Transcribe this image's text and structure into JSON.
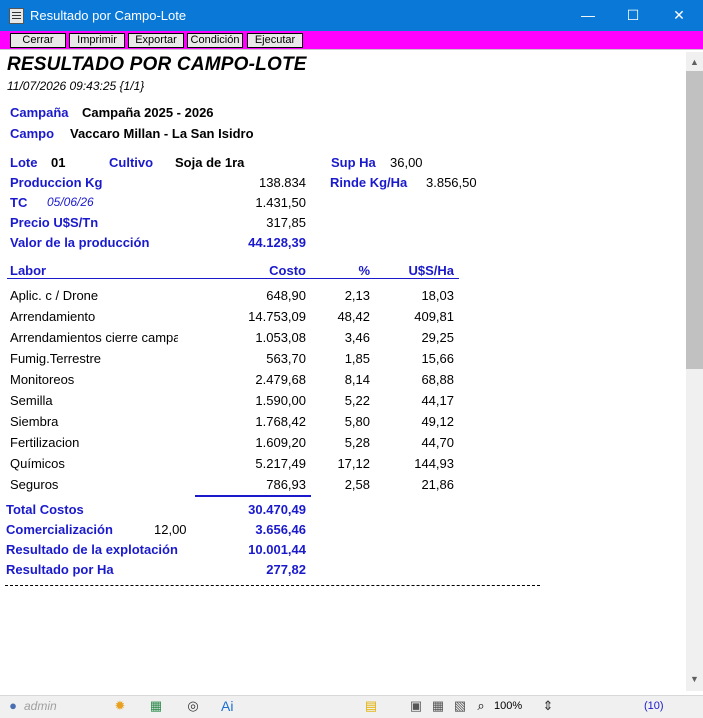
{
  "window": {
    "title": "Resultado por Campo-Lote",
    "minimize": "—",
    "maximize": "☐",
    "close": "✕"
  },
  "toolbar": {
    "cerrar": "Cerrar",
    "imprimir": "Imprimir",
    "exportar": "Exportar",
    "condicion": "Condición",
    "ejecutar": "Ejecutar"
  },
  "report": {
    "title": "RESULTADO POR CAMPO-LOTE",
    "datetime": "11/07/2026 09:43:25 {1/1}",
    "campana_label": "Campaña",
    "campana_value": "Campaña 2025 - 2026",
    "campo_label": "Campo",
    "campo_value": "Vaccaro Millan - La San Isidro",
    "lote_label": "Lote",
    "lote_value": "01",
    "cultivo_label": "Cultivo",
    "cultivo_value": "Soja de 1ra",
    "sup_label": "Sup Ha",
    "sup_value": "36,00",
    "prod_label": "Produccion Kg",
    "prod_value": "138.834",
    "rinde_label": "Rinde Kg/Ha",
    "rinde_value": "3.856,50",
    "tc_label": "TC",
    "tc_date": "05/06/26",
    "tc_value": "1.431,50",
    "precio_label": "Precio U$S/Tn",
    "precio_value": "317,85",
    "valor_label": "Valor de la producción",
    "valor_value": "44.128,39",
    "headers": {
      "labor": "Labor",
      "costo": "Costo",
      "pct": "%",
      "usha": "U$S/Ha"
    },
    "rows": [
      {
        "labor": "Aplic. c / Drone",
        "costo": "648,90",
        "pct": "2,13",
        "usha": "18,03"
      },
      {
        "labor": "Arrendamiento",
        "costo": "14.753,09",
        "pct": "48,42",
        "usha": "409,81"
      },
      {
        "labor": "Arrendamientos cierre campa",
        "costo": "1.053,08",
        "pct": "3,46",
        "usha": "29,25"
      },
      {
        "labor": "Fumig.Terrestre",
        "costo": "563,70",
        "pct": "1,85",
        "usha": "15,66"
      },
      {
        "labor": "Monitoreos",
        "costo": "2.479,68",
        "pct": "8,14",
        "usha": "68,88"
      },
      {
        "labor": "Semilla",
        "costo": "1.590,00",
        "pct": "5,22",
        "usha": "44,17"
      },
      {
        "labor": "Siembra",
        "costo": "1.768,42",
        "pct": "5,80",
        "usha": "49,12"
      },
      {
        "labor": "Fertilizacion",
        "costo": "1.609,20",
        "pct": "5,28",
        "usha": "44,70"
      },
      {
        "labor": "Químicos",
        "costo": "5.217,49",
        "pct": "17,12",
        "usha": "144,93"
      },
      {
        "labor": "Seguros",
        "costo": "786,93",
        "pct": "2,58",
        "usha": "21,86"
      }
    ],
    "total_label": "Total Costos",
    "total_value": "30.470,49",
    "comerc_label": "Comercialización",
    "comerc_pct": "12,00",
    "comerc_value": "3.656,46",
    "resexp_label": "Resultado de la explotación",
    "resexp_value": "10.001,44",
    "resha_label": "Resultado por Ha",
    "resha_value": "277,82"
  },
  "statusbar": {
    "user": "admin",
    "ai": "Ai",
    "zoom": "100%",
    "count": "(10)"
  }
}
